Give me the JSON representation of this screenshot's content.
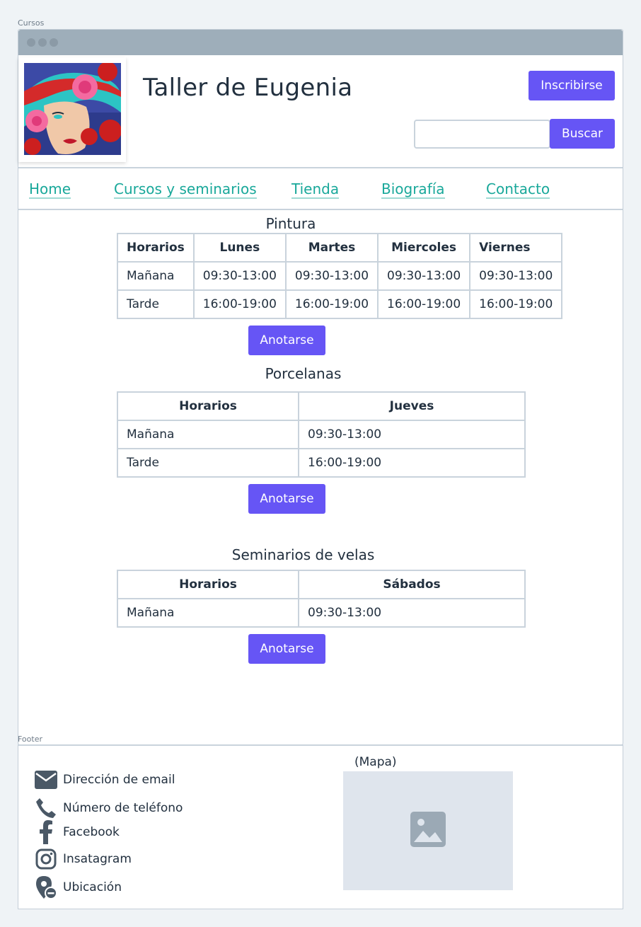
{
  "labels": {
    "section": "Cursos",
    "footer": "Footer"
  },
  "header": {
    "title": "Taller de Eugenia",
    "signup_label": "Inscribirse",
    "search_placeholder": "",
    "search_button": "Buscar"
  },
  "nav": [
    "Home",
    "Cursos y seminarios",
    "Tienda",
    "Biografía",
    "Contacto"
  ],
  "courses": [
    {
      "title": "Pintura",
      "columns": [
        "Horarios",
        "Lunes",
        "Martes",
        "Miercoles",
        "Viernes"
      ],
      "rows": [
        [
          "Mañana",
          "09:30-13:00",
          "09:30-13:00",
          "09:30-13:00",
          "09:30-13:00"
        ],
        [
          "Tarde",
          "16:00-19:00",
          "16:00-19:00",
          "16:00-19:00",
          "16:00-19:00"
        ]
      ],
      "button": "Anotarse"
    },
    {
      "title": "Porcelanas",
      "columns": [
        "Horarios",
        "Jueves"
      ],
      "rows": [
        [
          "Mañana",
          "09:30-13:00"
        ],
        [
          "Tarde",
          "16:00-19:00"
        ]
      ],
      "button": "Anotarse"
    },
    {
      "title": "Seminarios de velas",
      "columns": [
        "Horarios",
        "Sábados"
      ],
      "rows": [
        [
          "Mañana",
          "09:30-13:00"
        ]
      ],
      "button": "Anotarse"
    }
  ],
  "footer": {
    "contacts": [
      {
        "icon": "mail-icon",
        "label": "Dirección de email"
      },
      {
        "icon": "phone-icon",
        "label": "Número de teléfono"
      },
      {
        "icon": "facebook-icon",
        "label": "Facebook"
      },
      {
        "icon": "instagram-icon",
        "label": "Insatagram"
      },
      {
        "icon": "location-icon",
        "label": "Ubicación"
      }
    ],
    "map_label": "(Mapa)",
    "map_icon": "image-placeholder-icon"
  },
  "colors": {
    "accent": "#6655f5",
    "link": "#19a89a",
    "chrome": "#9eaeba",
    "text": "#22303f"
  }
}
